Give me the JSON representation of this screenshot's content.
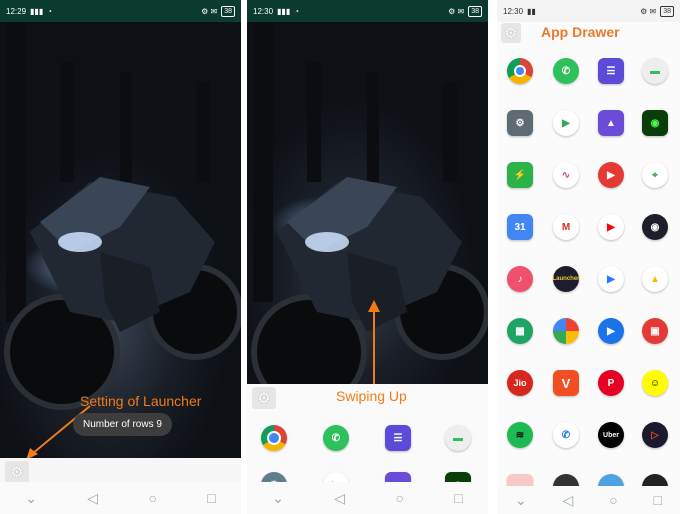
{
  "screens": [
    {
      "status": {
        "time": "12:29",
        "battery": "38"
      },
      "annotation": "Setting of Launcher",
      "toast": "Number of rows 9"
    },
    {
      "status": {
        "time": "12:30",
        "battery": "38"
      },
      "annotation": "Swiping Up"
    },
    {
      "status": {
        "time": "12:30",
        "battery": "38"
      },
      "title": "App Drawer"
    }
  ],
  "icons": {
    "dock": [
      "chrome-icon",
      "phone-icon",
      "contacts-icon",
      "messages-icon"
    ],
    "drawer": [
      [
        "chrome-icon",
        "phone-icon",
        "contacts-icon",
        "messages-icon"
      ],
      [
        "settings-icon",
        "play-store-icon",
        "gallery-icon",
        "android-terminal-icon"
      ],
      [
        "security-shield-icon",
        "audio-icon",
        "video-player-icon",
        "maps-icon"
      ],
      [
        "calendar-icon",
        "gmail-icon",
        "youtube-icon",
        "camera-icon"
      ],
      [
        "music-icon",
        "launcher-icon",
        "play-games-icon",
        "drive-icon"
      ],
      [
        "sheets-icon",
        "photos-icon",
        "meet-icon",
        "yt-studio-icon"
      ],
      [
        "jio-icon",
        "vlc-icon",
        "pinterest-icon",
        "snapchat-icon"
      ],
      [
        "spotify-icon",
        "dialer-icon",
        "uber-icon",
        "media-icon"
      ]
    ]
  },
  "drawer_labels": {
    "jio": "Jio",
    "vlc": "V",
    "uber": "Uber",
    "launcher": "Launcher",
    "calendar": "31"
  },
  "colors": {
    "accent": "#f07c17",
    "statusbar": "#0b3a2f"
  }
}
